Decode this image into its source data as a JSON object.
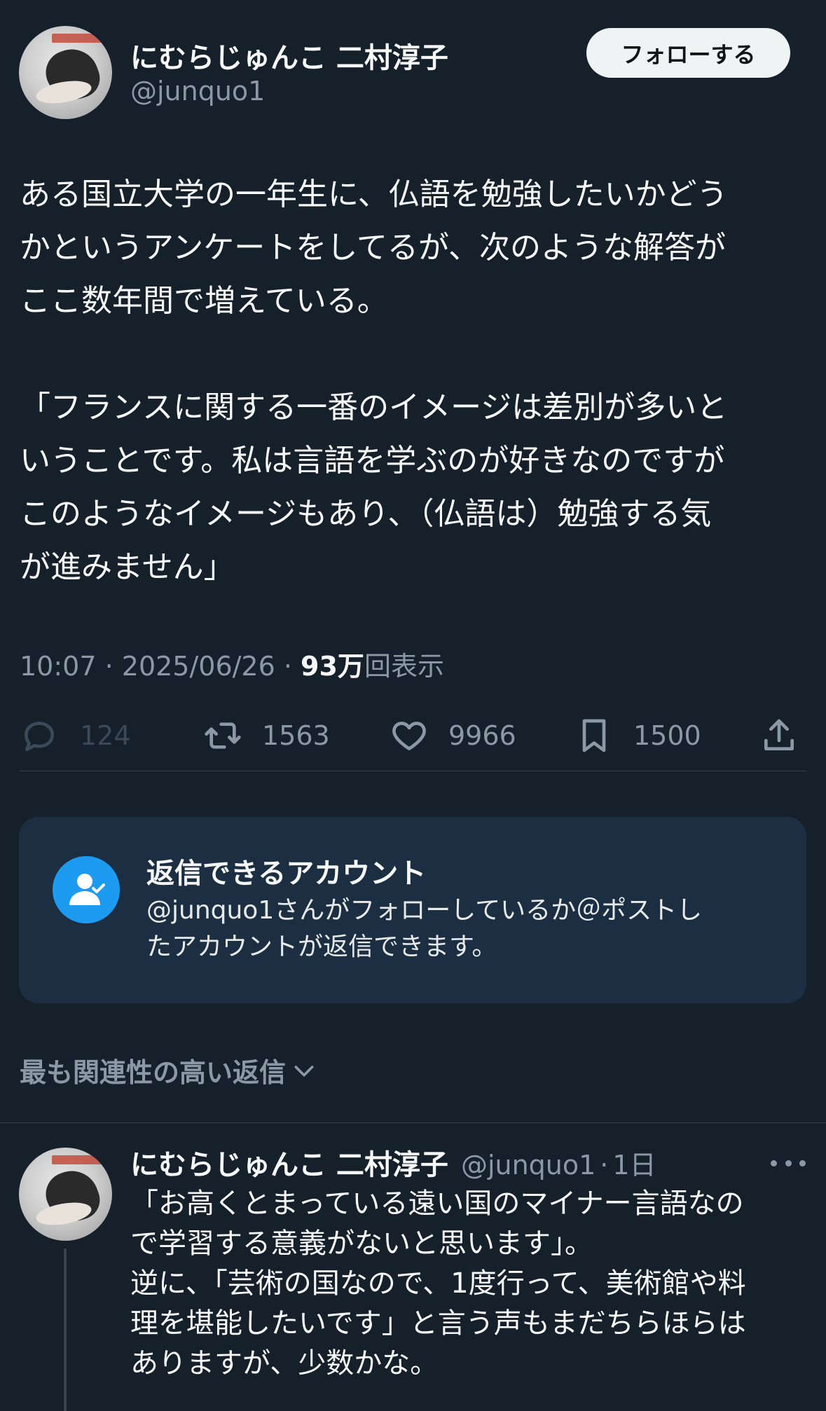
{
  "header": {
    "display_name": "にむらじゅんこ 二村淳子",
    "handle": "@junquo1",
    "follow_label": "フォローする"
  },
  "tweet": {
    "lines": [
      "ある国立大学の一年生に、仏語を勉強したいかどう",
      "かというアンケートをしてるが、次のような解答が",
      "ここ数年間で増えている。",
      "",
      "「フランスに関する一番のイメージは差別が多いと",
      "いうことです。私は言語を学ぶのが好きなのですが",
      "このようなイメージもあり、（仏語は）勉強する気",
      "が進みません」"
    ],
    "time": "10:07",
    "sep1": " · ",
    "date": "2025/06/26",
    "sep2": " · ",
    "views": "93万",
    "views_label": "回表示"
  },
  "actions": {
    "replies": "124",
    "retweets": "1563",
    "likes": "9966",
    "bookmarks": "1500",
    "icons": [
      "reply-icon",
      "retweet-icon",
      "like-icon",
      "bookmark-icon",
      "share-icon"
    ]
  },
  "reply_restriction": {
    "title": "返信できるアカウント",
    "line1": "@junquo1さんがフォローしているか＠ポストし",
    "line2": "たアカウントが返信できます。",
    "icon": "user-check-icon",
    "accent": "#1d9bf0"
  },
  "sort": {
    "label": "最も関連性の高い返信"
  },
  "reply": {
    "display_name": "にむらじゅんこ 二村淳子",
    "handle": "@junquo1",
    "dot": "·",
    "time": "1日",
    "lines": [
      "「お高くとまっている遠い国のマイナー言語なの",
      "で学習する意義がないと思います」。",
      "逆に、「芸術の国なので、1度行って、美術館や料",
      "理を堪能したいです」と言う声もまだちらほらは",
      "ありますが、少数かな。"
    ]
  },
  "colors": {
    "background": "#15202b",
    "card": "#1c2f42",
    "muted": "#8b98a5",
    "text": "#f7f9f9"
  }
}
